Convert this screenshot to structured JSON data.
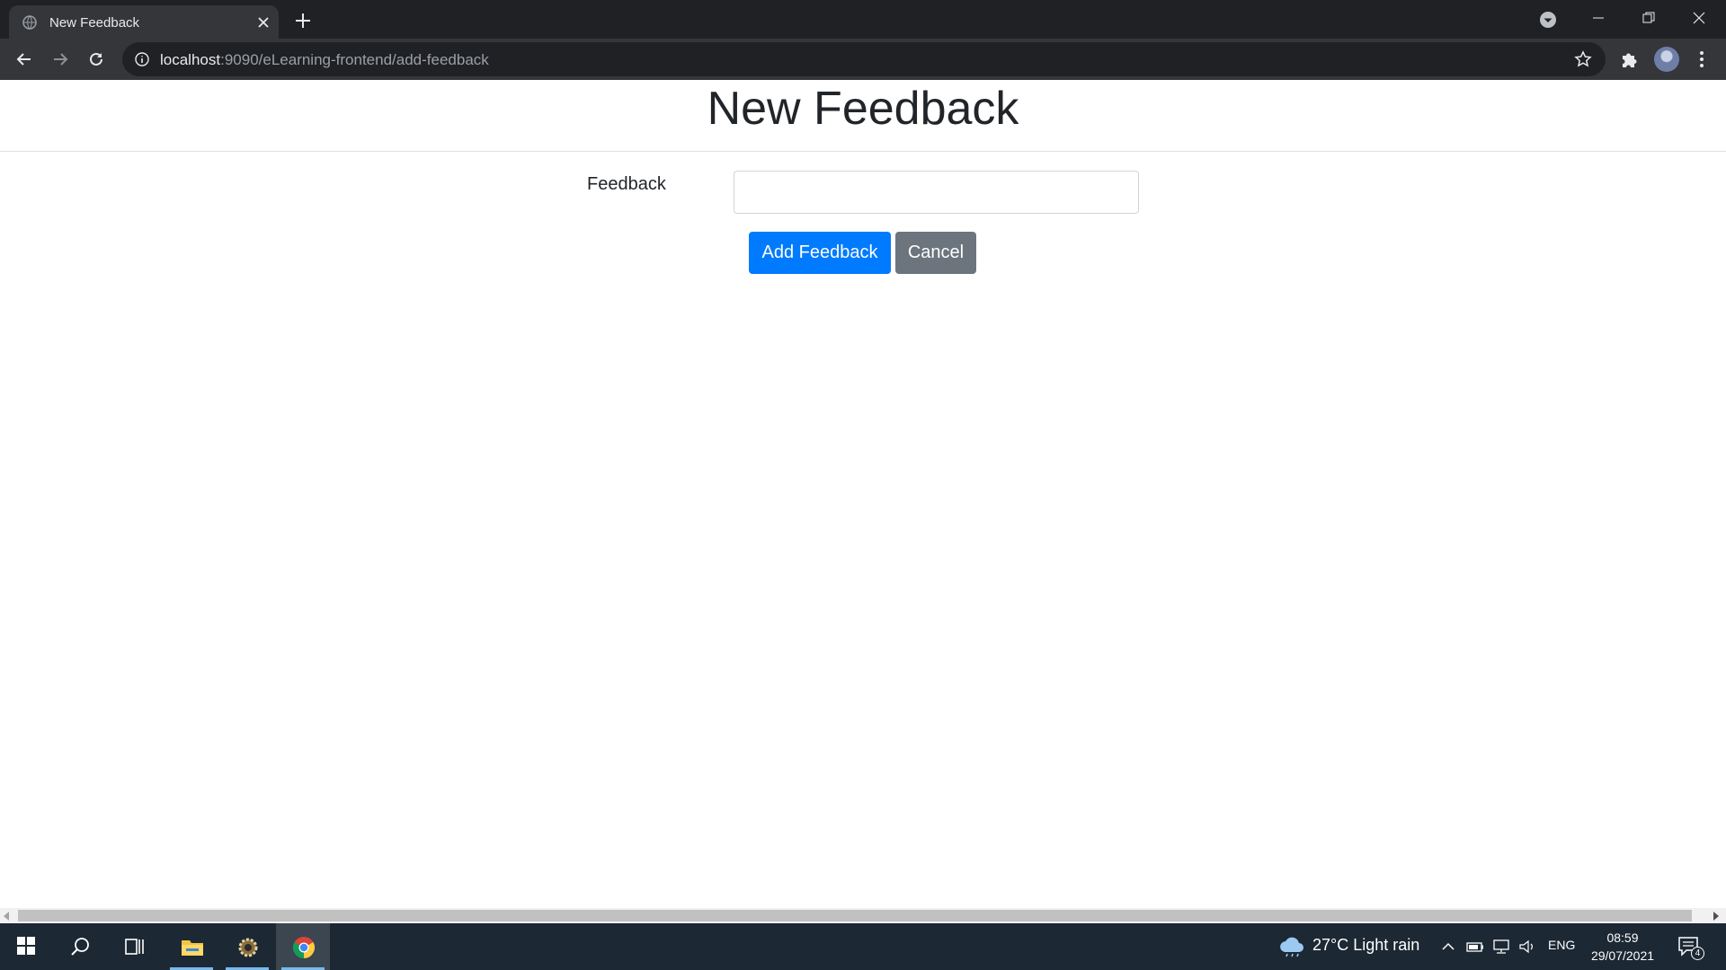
{
  "browser": {
    "tab_title": "New Feedback",
    "url_host": "localhost",
    "url_rest": ":9090/eLearning-frontend/add-feedback"
  },
  "page": {
    "title": "New Feedback",
    "form": {
      "feedback_label": "Feedback",
      "feedback_value": "",
      "submit_label": "Add Feedback",
      "cancel_label": "Cancel"
    }
  },
  "taskbar": {
    "weather": "27°C  Light rain",
    "language": "ENG",
    "time": "08:59",
    "date": "29/07/2021",
    "notification_count": "4"
  },
  "colors": {
    "primary": "#007bff",
    "secondary": "#6c757d",
    "chrome_dark": "#202124",
    "taskbar": "#1c2833"
  }
}
